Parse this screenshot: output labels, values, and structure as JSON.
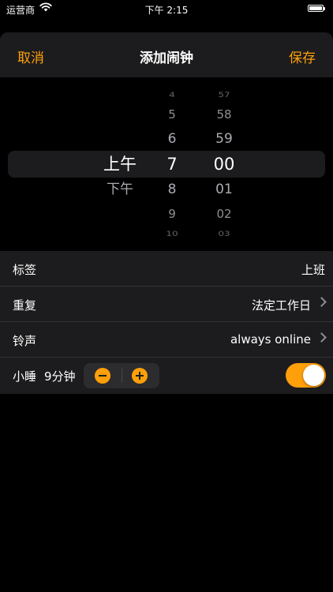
{
  "status_bar": {
    "carrier": "运营商",
    "time": "下午 2:15",
    "battery_level": 1.0
  },
  "nav": {
    "cancel_label": "取消",
    "title": "添加闹钟",
    "save_label": "保存"
  },
  "picker": {
    "ampm": {
      "items": [
        "上午",
        "下午"
      ],
      "selected": "上午"
    },
    "hour": {
      "items": [
        "4",
        "5",
        "6",
        "7",
        "8",
        "9",
        "10"
      ],
      "selected": "7"
    },
    "minute": {
      "items": [
        "57",
        "58",
        "59",
        "00",
        "01",
        "02",
        "03"
      ],
      "selected": "00"
    }
  },
  "settings": {
    "label_row": {
      "label": "标签",
      "value": "上班"
    },
    "repeat_row": {
      "label": "重复",
      "value": "法定工作日"
    },
    "sound_row": {
      "label": "铃声",
      "value": "always online"
    },
    "snooze_row": {
      "label": "小睡",
      "value": "9分钟",
      "enabled": true
    }
  },
  "colors": {
    "accent": "#ff9f0a",
    "background": "#000000",
    "cell": "#1c1c1e"
  },
  "icons": {
    "wifi": "wifi-icon",
    "battery": "battery-icon",
    "chevron": "chevron-right-icon",
    "minus": "minus-circle-icon",
    "plus": "plus-circle-icon"
  }
}
